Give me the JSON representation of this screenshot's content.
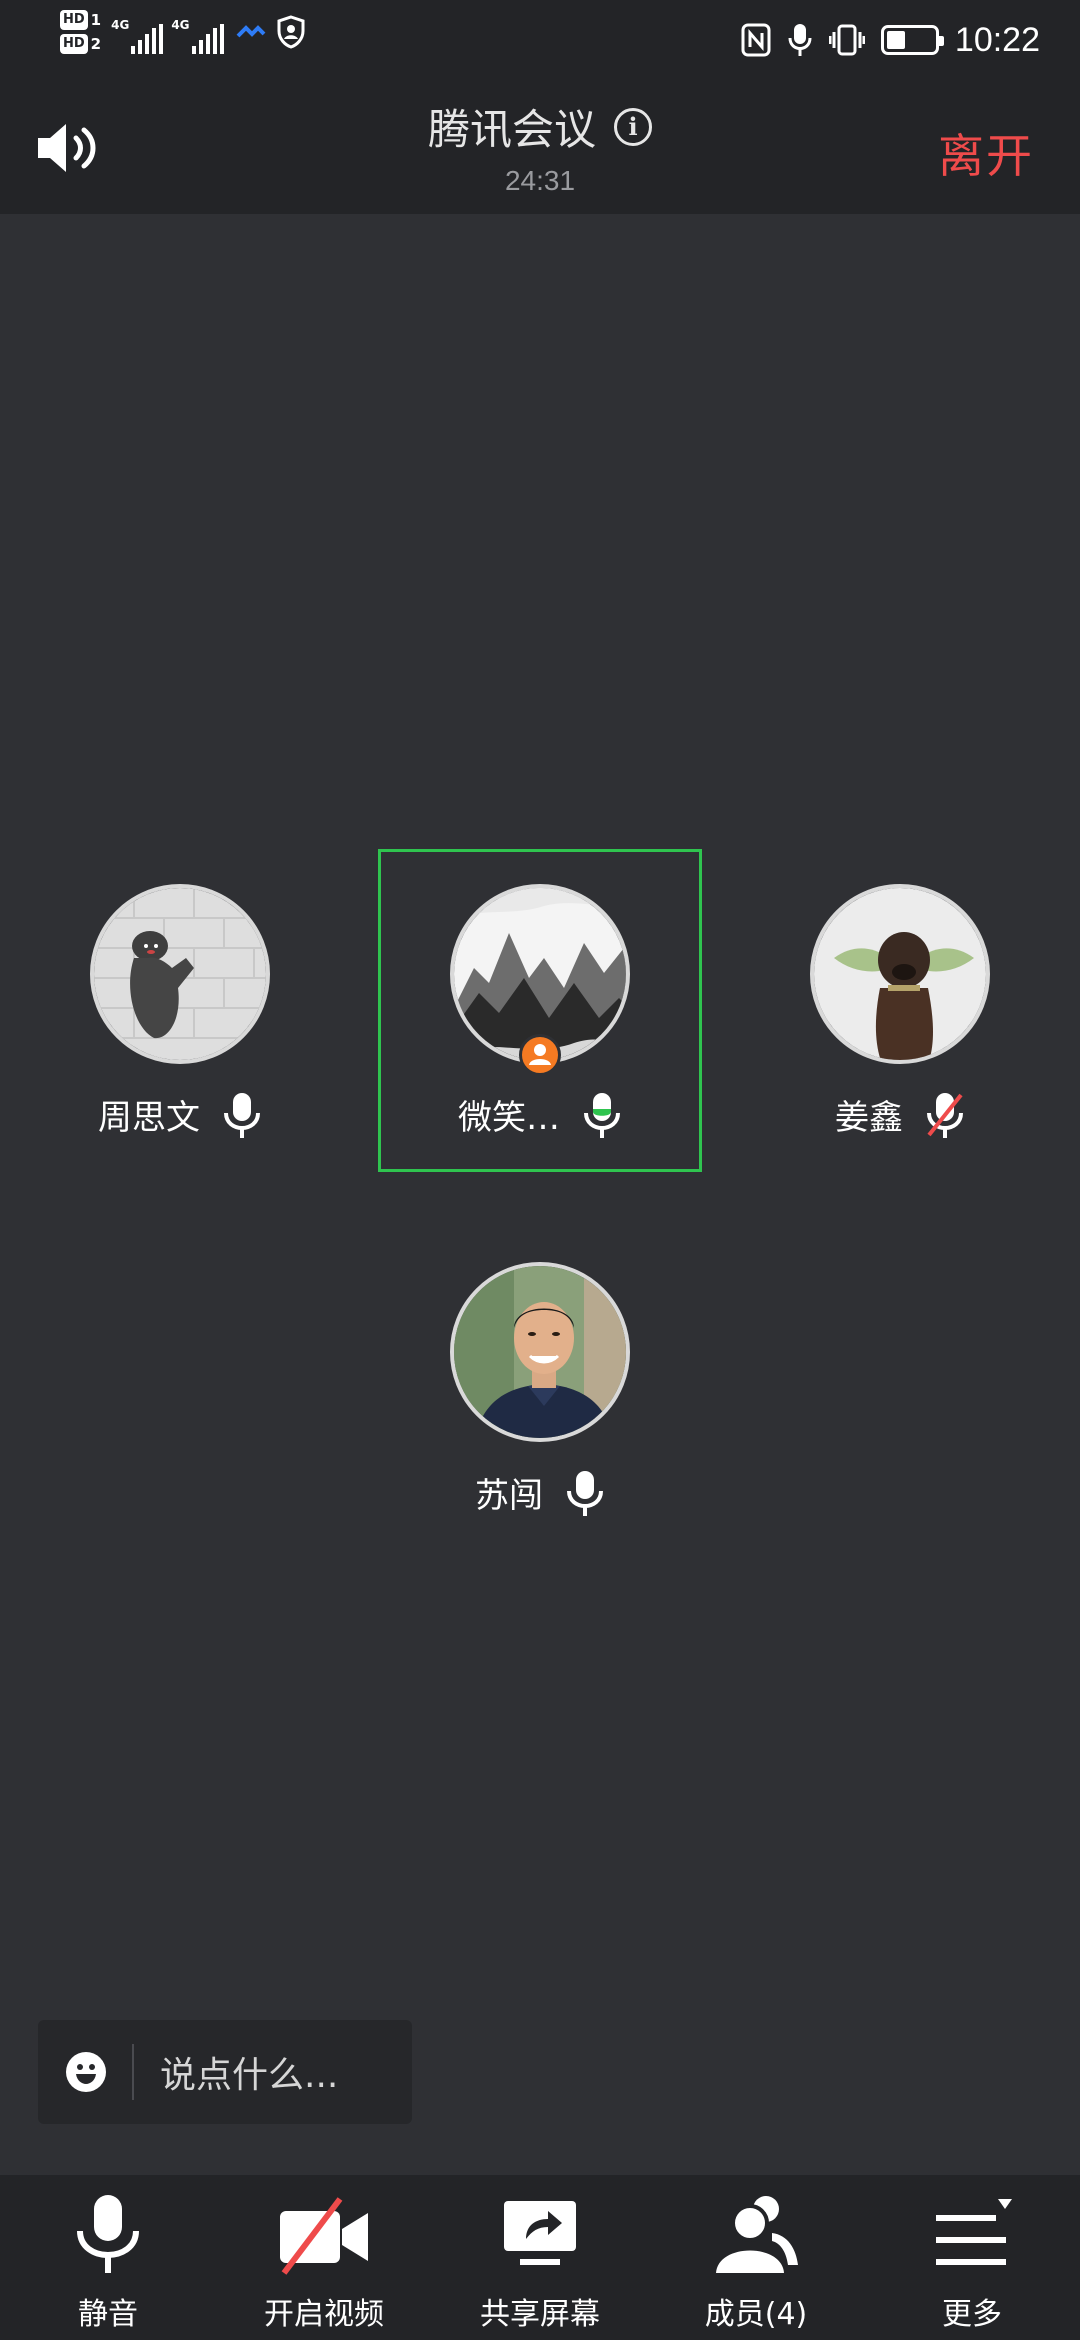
{
  "status_bar": {
    "sim1": "HD",
    "sim1_num": "1",
    "sim2": "HD",
    "sim2_num": "2",
    "network1": "4G",
    "network2": "4G",
    "time": "10:22",
    "battery_level": 0.35,
    "icons": [
      "nfc-icon",
      "mic-icon",
      "vibrate-icon",
      "battery-icon",
      "vpn-icon",
      "shield-icon"
    ]
  },
  "header": {
    "title": "腾讯会议",
    "duration": "24:31",
    "leave_label": "离开"
  },
  "participants": [
    {
      "name": "周思文",
      "mic": "on",
      "avatar": "bear-on-brick-wall"
    },
    {
      "name": "微笑…",
      "mic": "active",
      "avatar": "ink-mountains",
      "is_host": true,
      "speaking": true
    },
    {
      "name": "姜鑫",
      "mic": "muted",
      "avatar": "dog-with-green-ears"
    },
    {
      "name": "苏闯",
      "mic": "on",
      "avatar": "man-portrait"
    }
  ],
  "chat": {
    "placeholder": "说点什么..."
  },
  "toolbar": {
    "mute_label": "静音",
    "video_label": "开启视频",
    "share_label": "共享屏幕",
    "members_label": "成员(4)",
    "more_label": "更多"
  },
  "colors": {
    "background": "#2f3034",
    "bar": "#232427",
    "leave": "#ef4b4b",
    "active_frame": "#2fc44f",
    "host_badge": "#f57a22"
  }
}
